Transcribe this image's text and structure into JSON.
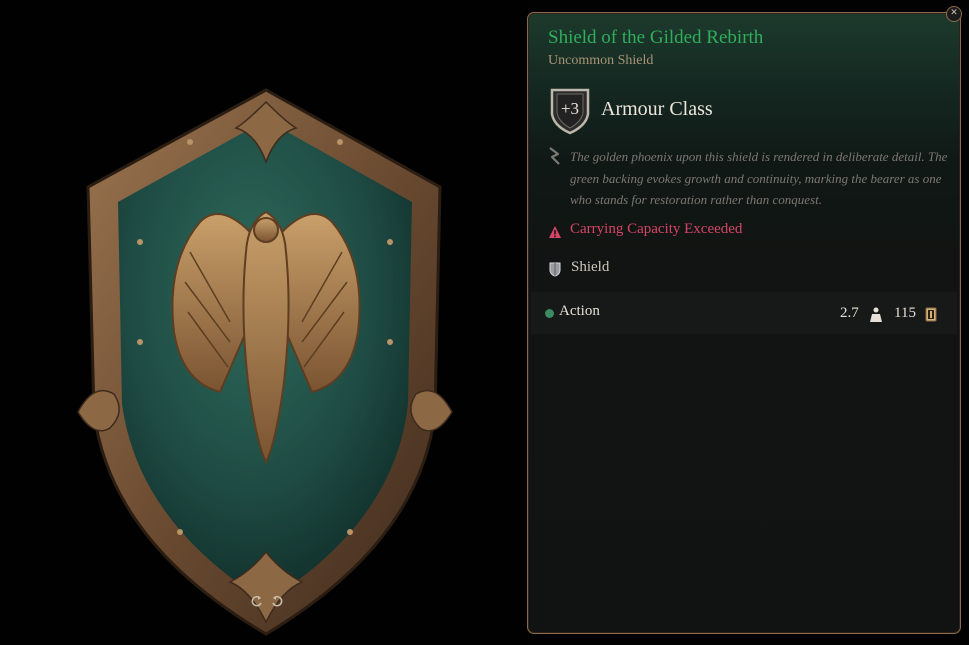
{
  "item": {
    "name": "Shield of the Gilded Rebirth",
    "rarity_type": "Uncommon Shield",
    "armour_class_value": "+3",
    "armour_class_label": "Armour Class",
    "description": "The golden phoenix upon this shield is rendered in deliberate detail. The green backing evokes growth and continuity, marking the bearer as one who stands for restoration rather than conquest.",
    "warning": "Carrying Capacity Exceeded",
    "category": "Shield",
    "action_label": "Action",
    "weight": "2.7",
    "price": "115"
  },
  "colors": {
    "name_color": "#2fae5d",
    "warning_color": "#d64568",
    "border_color": "#8a6a48"
  },
  "icons": {
    "close": "close-icon",
    "armour": "shield-badge-icon",
    "description": "quill-icon",
    "warning": "warning-triangle-icon",
    "category": "shield-icon",
    "action": "action-dot-icon",
    "weight": "weight-icon",
    "price": "gold-coin-icon",
    "rotate_left": "rotate-left-icon",
    "rotate_right": "rotate-right-icon"
  }
}
